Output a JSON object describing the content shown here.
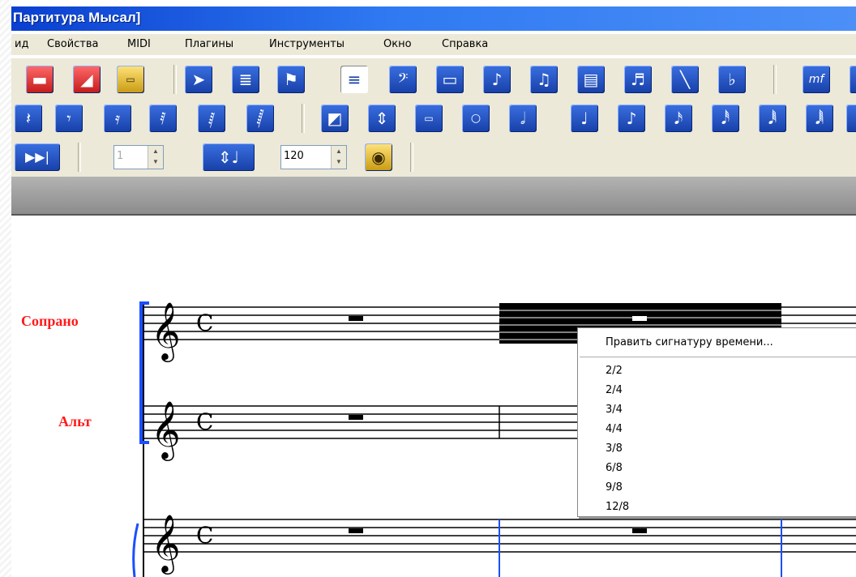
{
  "window": {
    "title": "Партитура Мысал]"
  },
  "menu": [
    "ид",
    "Свойства",
    "MIDI",
    "Плагины",
    "Инструменты",
    "Окно",
    "Справка"
  ],
  "toolbar3": {
    "bar_value": "1",
    "tempo_separator": "-",
    "tempo_value": "120"
  },
  "staves": [
    {
      "name": "Сопрано"
    },
    {
      "name": "Альт"
    }
  ],
  "clef_icon": "treble-clef-icon",
  "time_signature_symbol": "C",
  "context_menu": {
    "title": "Править сигнатуру времени...",
    "options": [
      "2/2",
      "2/4",
      "3/4",
      "4/4",
      "3/8",
      "6/8",
      "9/8",
      "12/8"
    ]
  },
  "colors": {
    "staff_name": "#ff1a1a",
    "bracket": "#1a4fff",
    "titlebar": "#0a3fd0",
    "selection": "#000000"
  }
}
